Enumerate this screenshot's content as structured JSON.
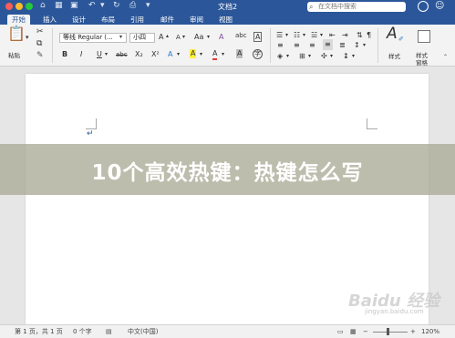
{
  "window": {
    "title": "文档2",
    "search_placeholder": "在文档中搜索"
  },
  "tabs": [
    "开始",
    "插入",
    "设计",
    "布局",
    "引用",
    "邮件",
    "审阅",
    "视图"
  ],
  "ribbon": {
    "paste_label": "粘贴",
    "font_name": "等线 Regular (...",
    "font_size": "小四",
    "styles_label": "样式",
    "styles_pane_label_line1": "样式",
    "styles_pane_label_line2": "窗格",
    "bold": "B",
    "italic": "I",
    "underline": "U",
    "strikethrough": "abc",
    "subscript": "X₂",
    "superscript": "X²",
    "grow_font": "A",
    "shrink_font": "A",
    "change_case": "Aa",
    "text_effects": "A",
    "highlight": "A",
    "font_color": "A",
    "char_shading": "A",
    "enclose": "字",
    "phonetic": "abc",
    "char_border": "A"
  },
  "banner": {
    "text": "10个高效热键：热键怎么写"
  },
  "watermark": {
    "logo": "Baidu 经验",
    "url": "jingyan.baidu.com"
  },
  "status": {
    "page": "第 1 页，共 1 页",
    "words": "0 个字",
    "language": "中文(中国)",
    "zoom": "120%"
  },
  "colors": {
    "ribbon_blue": "#2b579a",
    "banner_overlay": "#aaaa96"
  }
}
